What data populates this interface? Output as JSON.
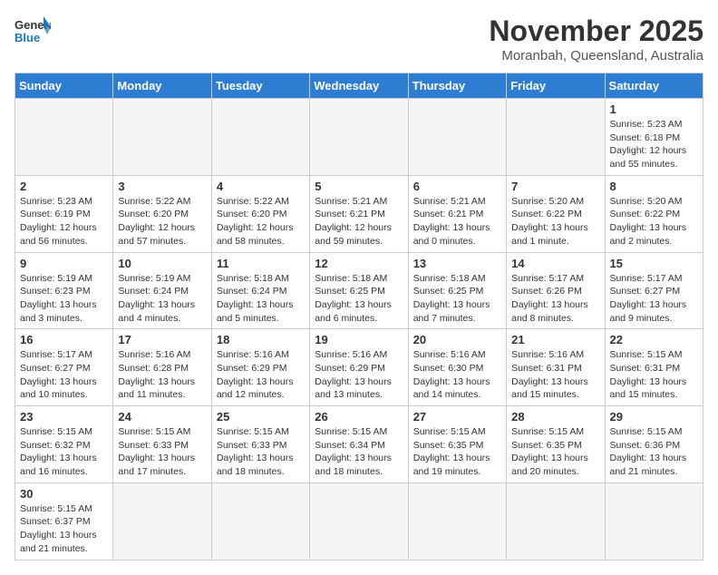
{
  "header": {
    "logo_general": "General",
    "logo_blue": "Blue",
    "month": "November 2025",
    "location": "Moranbah, Queensland, Australia"
  },
  "weekdays": [
    "Sunday",
    "Monday",
    "Tuesday",
    "Wednesday",
    "Thursday",
    "Friday",
    "Saturday"
  ],
  "weeks": [
    [
      {
        "day": "",
        "info": ""
      },
      {
        "day": "",
        "info": ""
      },
      {
        "day": "",
        "info": ""
      },
      {
        "day": "",
        "info": ""
      },
      {
        "day": "",
        "info": ""
      },
      {
        "day": "",
        "info": ""
      },
      {
        "day": "1",
        "info": "Sunrise: 5:23 AM\nSunset: 6:18 PM\nDaylight: 12 hours and 55 minutes."
      }
    ],
    [
      {
        "day": "2",
        "info": "Sunrise: 5:23 AM\nSunset: 6:19 PM\nDaylight: 12 hours and 56 minutes."
      },
      {
        "day": "3",
        "info": "Sunrise: 5:22 AM\nSunset: 6:20 PM\nDaylight: 12 hours and 57 minutes."
      },
      {
        "day": "4",
        "info": "Sunrise: 5:22 AM\nSunset: 6:20 PM\nDaylight: 12 hours and 58 minutes."
      },
      {
        "day": "5",
        "info": "Sunrise: 5:21 AM\nSunset: 6:21 PM\nDaylight: 12 hours and 59 minutes."
      },
      {
        "day": "6",
        "info": "Sunrise: 5:21 AM\nSunset: 6:21 PM\nDaylight: 13 hours and 0 minutes."
      },
      {
        "day": "7",
        "info": "Sunrise: 5:20 AM\nSunset: 6:22 PM\nDaylight: 13 hours and 1 minute."
      },
      {
        "day": "8",
        "info": "Sunrise: 5:20 AM\nSunset: 6:22 PM\nDaylight: 13 hours and 2 minutes."
      }
    ],
    [
      {
        "day": "9",
        "info": "Sunrise: 5:19 AM\nSunset: 6:23 PM\nDaylight: 13 hours and 3 minutes."
      },
      {
        "day": "10",
        "info": "Sunrise: 5:19 AM\nSunset: 6:24 PM\nDaylight: 13 hours and 4 minutes."
      },
      {
        "day": "11",
        "info": "Sunrise: 5:18 AM\nSunset: 6:24 PM\nDaylight: 13 hours and 5 minutes."
      },
      {
        "day": "12",
        "info": "Sunrise: 5:18 AM\nSunset: 6:25 PM\nDaylight: 13 hours and 6 minutes."
      },
      {
        "day": "13",
        "info": "Sunrise: 5:18 AM\nSunset: 6:25 PM\nDaylight: 13 hours and 7 minutes."
      },
      {
        "day": "14",
        "info": "Sunrise: 5:17 AM\nSunset: 6:26 PM\nDaylight: 13 hours and 8 minutes."
      },
      {
        "day": "15",
        "info": "Sunrise: 5:17 AM\nSunset: 6:27 PM\nDaylight: 13 hours and 9 minutes."
      }
    ],
    [
      {
        "day": "16",
        "info": "Sunrise: 5:17 AM\nSunset: 6:27 PM\nDaylight: 13 hours and 10 minutes."
      },
      {
        "day": "17",
        "info": "Sunrise: 5:16 AM\nSunset: 6:28 PM\nDaylight: 13 hours and 11 minutes."
      },
      {
        "day": "18",
        "info": "Sunrise: 5:16 AM\nSunset: 6:29 PM\nDaylight: 13 hours and 12 minutes."
      },
      {
        "day": "19",
        "info": "Sunrise: 5:16 AM\nSunset: 6:29 PM\nDaylight: 13 hours and 13 minutes."
      },
      {
        "day": "20",
        "info": "Sunrise: 5:16 AM\nSunset: 6:30 PM\nDaylight: 13 hours and 14 minutes."
      },
      {
        "day": "21",
        "info": "Sunrise: 5:16 AM\nSunset: 6:31 PM\nDaylight: 13 hours and 15 minutes."
      },
      {
        "day": "22",
        "info": "Sunrise: 5:15 AM\nSunset: 6:31 PM\nDaylight: 13 hours and 15 minutes."
      }
    ],
    [
      {
        "day": "23",
        "info": "Sunrise: 5:15 AM\nSunset: 6:32 PM\nDaylight: 13 hours and 16 minutes."
      },
      {
        "day": "24",
        "info": "Sunrise: 5:15 AM\nSunset: 6:33 PM\nDaylight: 13 hours and 17 minutes."
      },
      {
        "day": "25",
        "info": "Sunrise: 5:15 AM\nSunset: 6:33 PM\nDaylight: 13 hours and 18 minutes."
      },
      {
        "day": "26",
        "info": "Sunrise: 5:15 AM\nSunset: 6:34 PM\nDaylight: 13 hours and 18 minutes."
      },
      {
        "day": "27",
        "info": "Sunrise: 5:15 AM\nSunset: 6:35 PM\nDaylight: 13 hours and 19 minutes."
      },
      {
        "day": "28",
        "info": "Sunrise: 5:15 AM\nSunset: 6:35 PM\nDaylight: 13 hours and 20 minutes."
      },
      {
        "day": "29",
        "info": "Sunrise: 5:15 AM\nSunset: 6:36 PM\nDaylight: 13 hours and 21 minutes."
      }
    ],
    [
      {
        "day": "30",
        "info": "Sunrise: 5:15 AM\nSunset: 6:37 PM\nDaylight: 13 hours and 21 minutes."
      },
      {
        "day": "",
        "info": ""
      },
      {
        "day": "",
        "info": ""
      },
      {
        "day": "",
        "info": ""
      },
      {
        "day": "",
        "info": ""
      },
      {
        "day": "",
        "info": ""
      },
      {
        "day": "",
        "info": ""
      }
    ]
  ]
}
